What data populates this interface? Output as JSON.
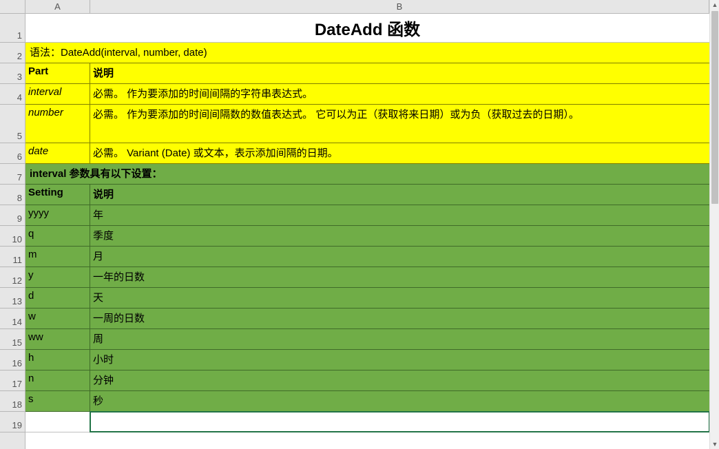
{
  "columns": {
    "A": "A",
    "B": "B"
  },
  "row_numbers": [
    "1",
    "2",
    "3",
    "4",
    "5",
    "6",
    "7",
    "8",
    "9",
    "10",
    "11",
    "12",
    "13",
    "14",
    "15",
    "16",
    "17",
    "18",
    "19"
  ],
  "title": "DateAdd 函数",
  "syntax": "语法：DateAdd(interval, number, date)",
  "head1": {
    "a": "Part",
    "b": "说明"
  },
  "r_interval": {
    "a": "interval",
    "b": "必需。 作为要添加的时间间隔的字符串表达式。"
  },
  "r_number": {
    "a": "number",
    "b": "必需。 作为要添加的时间间隔数的数值表达式。 它可以为正（获取将来日期）或为负（获取过去的日期）。"
  },
  "r_date": {
    "a": "date",
    "b": "必需。 Variant (Date) 或文本，表示添加间隔的日期。"
  },
  "interval_heading": "interval 参数具有以下设置：",
  "head2": {
    "a": "Setting",
    "b": "说明"
  },
  "settings": {
    "yyyy": {
      "a": "yyyy",
      "b": "年"
    },
    "q": {
      "a": "q",
      "b": "季度"
    },
    "m": {
      "a": "m",
      "b": "月"
    },
    "y": {
      "a": "y",
      "b": "一年的日数"
    },
    "d": {
      "a": "d",
      "b": "天"
    },
    "w": {
      "a": "w",
      "b": "一周的日数"
    },
    "ww": {
      "a": "ww",
      "b": "周"
    },
    "h": {
      "a": "h",
      "b": "小时"
    },
    "n": {
      "a": "n",
      "b": "分钟"
    },
    "s": {
      "a": "s",
      "b": "秒"
    }
  },
  "colors": {
    "yellow": "#ffff00",
    "green": "#70ad47",
    "selection": "#217346"
  }
}
